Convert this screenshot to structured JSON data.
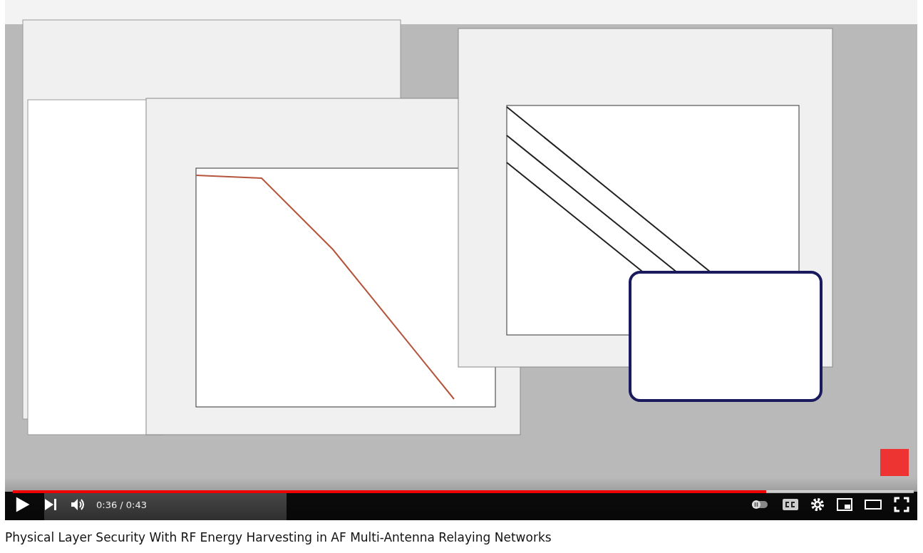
{
  "player": {
    "progress": {
      "level": 0.836
    },
    "time": "0:36 / 0:43"
  },
  "title": "Physical Layer Security With RF Energy Harvesting in AF Multi-Antenna Relaying Networks"
}
